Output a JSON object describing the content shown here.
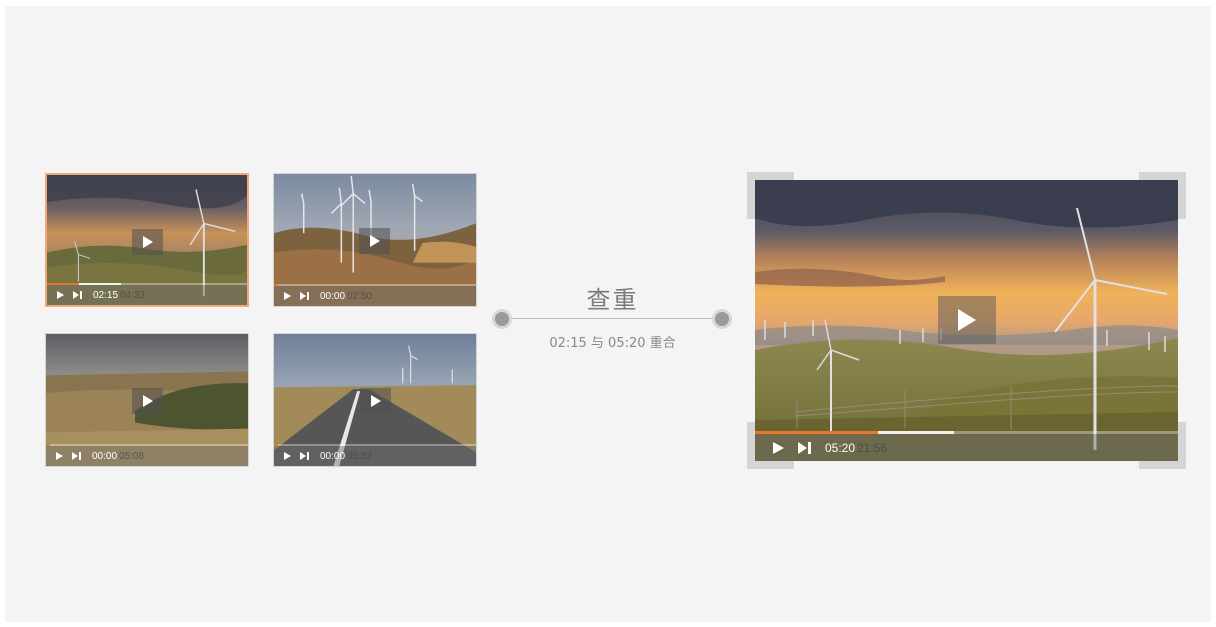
{
  "thumbnails": [
    {
      "id": "thumb-1",
      "current_time": "02:15",
      "duration": "04:32",
      "played_fraction": 0.16,
      "loaded_fraction": 0.37,
      "selected": true
    },
    {
      "id": "thumb-2",
      "current_time": "00:00",
      "duration": "02:50",
      "played_fraction": 0.02,
      "loaded_fraction": 0.0,
      "selected": false
    },
    {
      "id": "thumb-3",
      "current_time": "00:00",
      "duration": "05:08",
      "played_fraction": 0.02,
      "loaded_fraction": 0.0,
      "selected": false
    },
    {
      "id": "thumb-4",
      "current_time": "00:00",
      "duration": "05:52",
      "played_fraction": 0.02,
      "loaded_fraction": 0.0,
      "selected": false
    }
  ],
  "comparison": {
    "title": "查重",
    "description": "02:15 与 05:20 重合"
  },
  "main_player": {
    "current_time": "05:20",
    "duration": "21:56",
    "played_fraction": 0.29,
    "loaded_fraction": 0.47
  },
  "colors": {
    "accent": "#e8782d",
    "selected_border": "#f0a878",
    "background": "#f4f4f4"
  },
  "icons": [
    "play-icon",
    "skip-next-icon",
    "connector-dot"
  ]
}
